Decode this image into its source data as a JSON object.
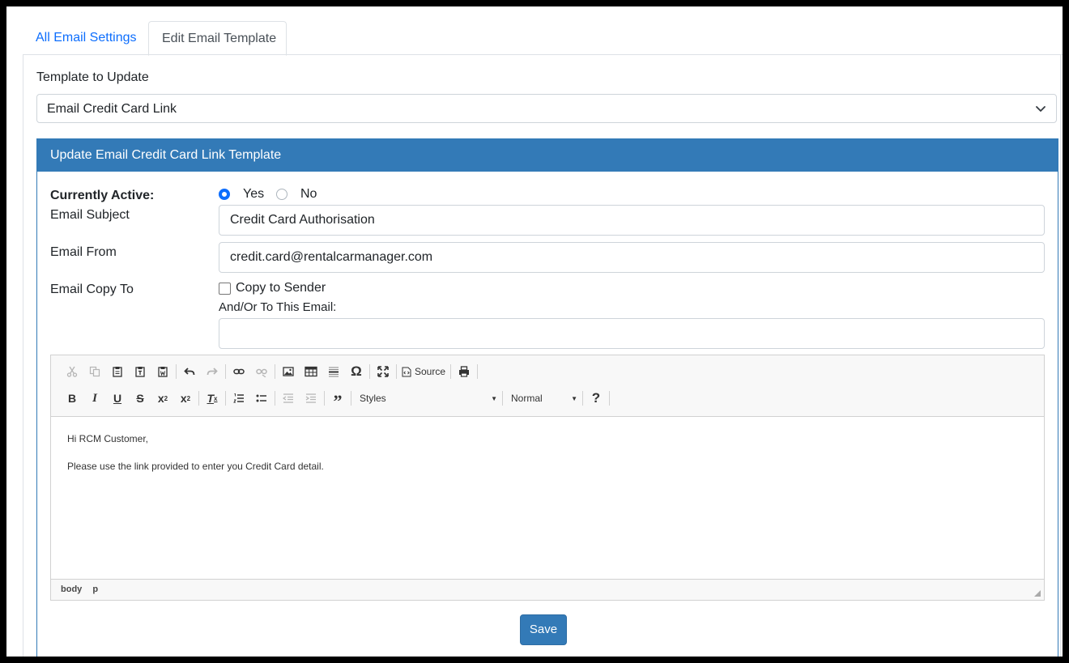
{
  "tabs": [
    {
      "label": "All Email Settings"
    },
    {
      "label": "Edit Email Template"
    }
  ],
  "template": {
    "label": "Template to Update",
    "selected": "Email Credit Card Link"
  },
  "panel": {
    "title": "Update Email Credit Card Link Template",
    "active_label": "Currently Active:",
    "yes_label": "Yes",
    "no_label": "No",
    "active_value": "Yes",
    "subject_label": "Email Subject",
    "subject_value": "Credit Card Authorisation",
    "from_label": "Email From",
    "from_value": "credit.card@rentalcarmanager.com",
    "copy_label": "Email Copy To",
    "copy_sender_label": "Copy to Sender",
    "copy_sender_checked": false,
    "andor_label": "And/Or To This Email:",
    "andor_value": ""
  },
  "editor": {
    "source_label": "Source",
    "styles_label": "Styles",
    "format_label": "Normal",
    "body_lines": [
      "Hi RCM Customer,",
      "Please use the link provided to enter you Credit Card detail."
    ],
    "path": [
      "body",
      "p"
    ]
  },
  "save_label": "Save",
  "colors": {
    "primary": "#337ab7",
    "link": "#0d6efd"
  }
}
